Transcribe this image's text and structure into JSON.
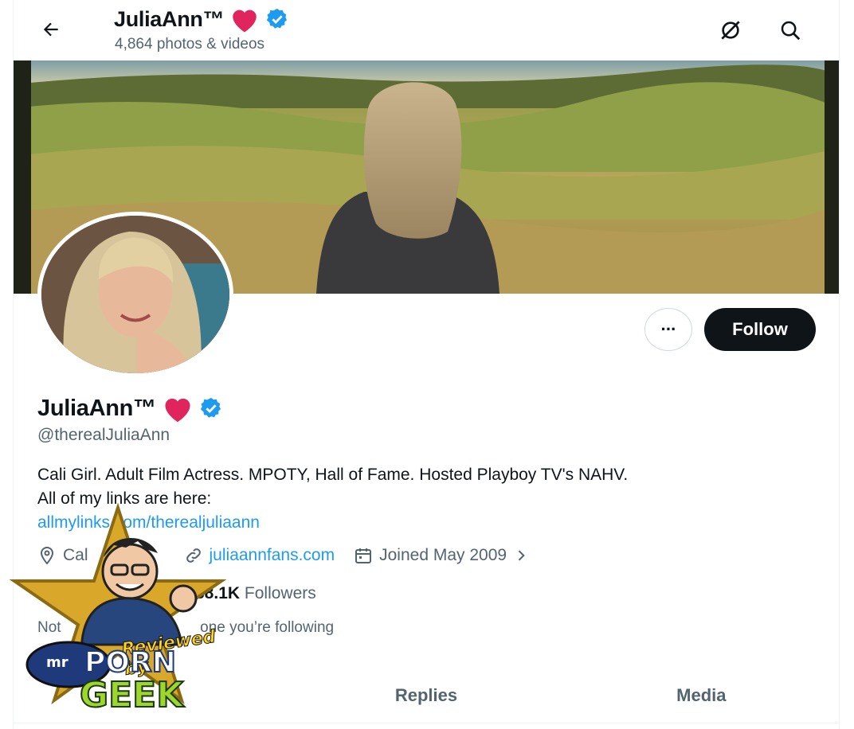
{
  "header": {
    "name": "JuliaAnn™",
    "media_count": "4,864 photos & videos",
    "icons": [
      "back-arrow-icon",
      "hide-icon",
      "search-icon"
    ]
  },
  "profile": {
    "name": "JuliaAnn™",
    "handle": "@therealJuliaAnn",
    "bio_line1": "Cali Girl. Adult Film Actress. MPOTY, Hall of Fame. Hosted Playboy TV's NAHV.",
    "bio_line2": "All of my links are here:",
    "bio_link": "allmylinks.com/therealjuliaann",
    "location": "Cal",
    "website": "juliaannfans.com",
    "joined": "Joined May 2009",
    "followers_count": "88.1K",
    "followers_label": "Followers",
    "not_followed_prefix": "Not",
    "not_followed_suffix": "one you’re following"
  },
  "actions": {
    "more_label": "···",
    "follow_label": "Follow"
  },
  "tabs": [
    {
      "label": ""
    },
    {
      "label": "Replies"
    },
    {
      "label": "Media"
    }
  ],
  "watermark": {
    "line1": "Reviewed by",
    "line2": "mr",
    "line3": "PORN",
    "line4": "GEEK"
  },
  "colors": {
    "accent": "#1d9bf0",
    "heart": "#e0245e",
    "text": "#0f1419",
    "secondary": "#536471"
  }
}
